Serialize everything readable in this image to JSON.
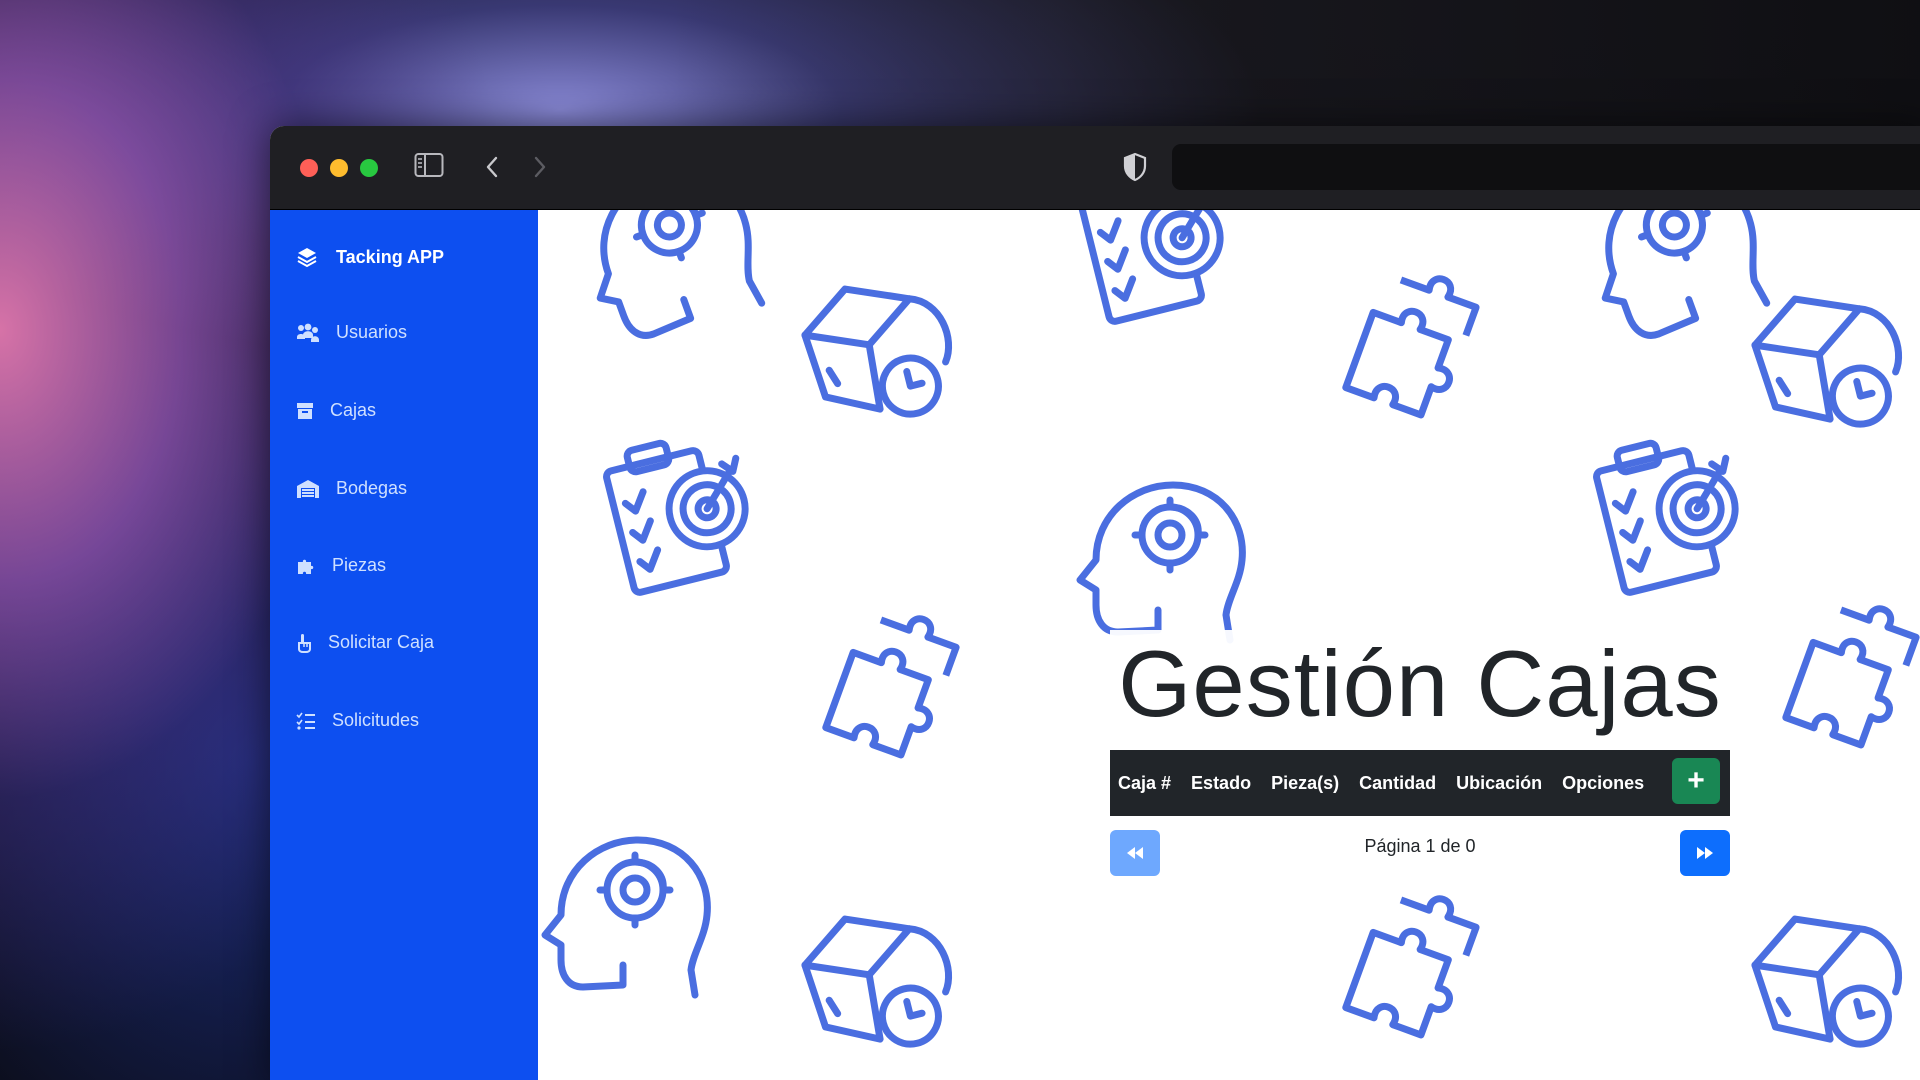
{
  "sidebar": {
    "brand": "Tacking APP",
    "items": [
      {
        "label": "Usuarios",
        "icon": "users-icon"
      },
      {
        "label": "Cajas",
        "icon": "box-icon"
      },
      {
        "label": "Bodegas",
        "icon": "warehouse-icon"
      },
      {
        "label": "Piezas",
        "icon": "puzzle-icon"
      },
      {
        "label": "Solicitar Caja",
        "icon": "hand-pointer-icon"
      },
      {
        "label": "Solicitudes",
        "icon": "list-check-icon"
      }
    ]
  },
  "main": {
    "title": "Gestión Cajas",
    "table": {
      "columns": [
        "Caja #",
        "Estado",
        "Pieza(s)",
        "Cantidad",
        "Ubicación",
        "Opciones"
      ],
      "add_label": "+"
    },
    "pagination": {
      "text": "Página 1 de 0"
    }
  },
  "colors": {
    "sidebar_bg": "#0d4ff0",
    "table_head_bg": "#212529",
    "add_button": "#198754",
    "pager_prev": "#6ea8fe",
    "pager_next": "#0d6efd",
    "doodle_stroke": "#4a6ee0"
  }
}
